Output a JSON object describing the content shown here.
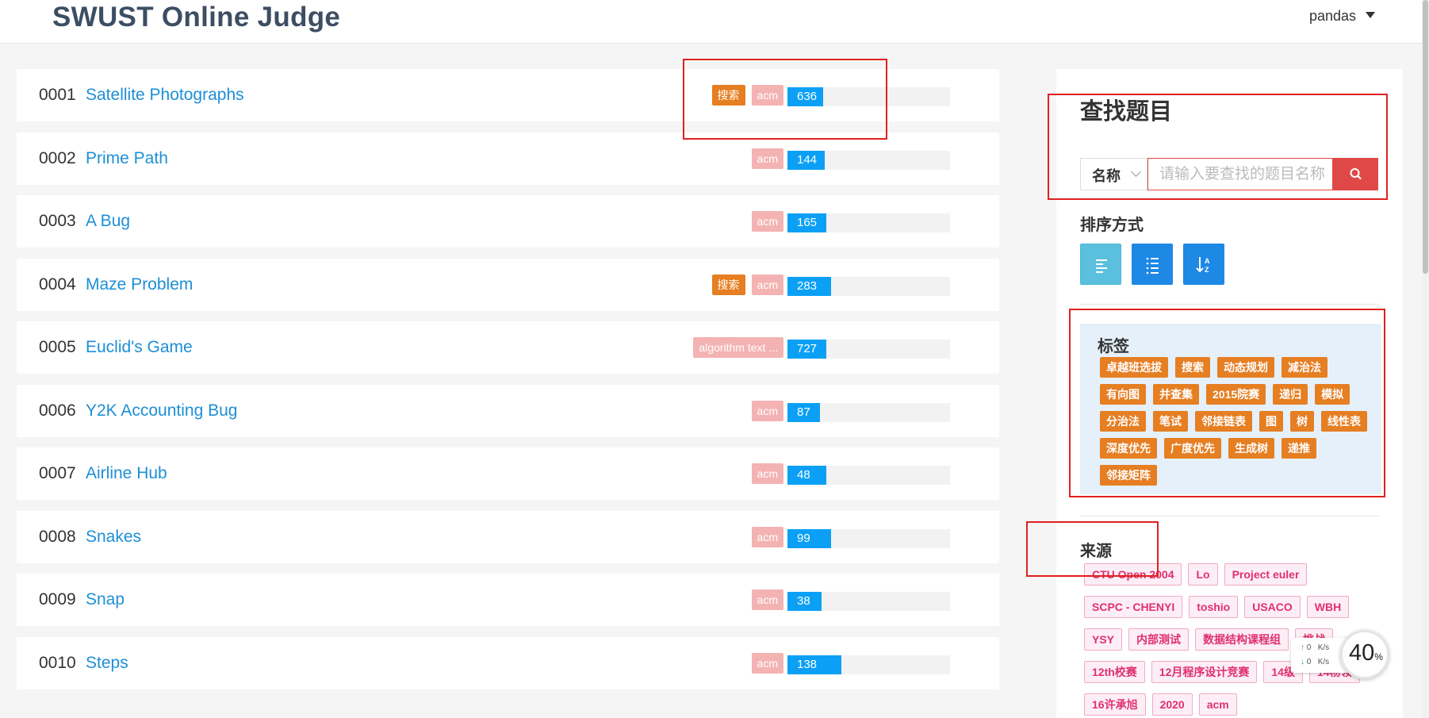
{
  "header": {
    "title": "SWUST Online Judge",
    "user": "pandas"
  },
  "problems": [
    {
      "id": "0001",
      "title": "Satellite Photographs",
      "tags": [
        "搜索",
        "acm"
      ],
      "count": "636",
      "pct": 0.22
    },
    {
      "id": "0002",
      "title": "Prime Path",
      "tags": [
        "acm"
      ],
      "count": "144",
      "pct": 0.23
    },
    {
      "id": "0003",
      "title": "A Bug",
      "tags": [
        "acm"
      ],
      "count": "165",
      "pct": 0.24
    },
    {
      "id": "0004",
      "title": "Maze Problem",
      "tags": [
        "搜索",
        "acm"
      ],
      "count": "283",
      "pct": 0.27
    },
    {
      "id": "0005",
      "title": "Euclid's Game",
      "tags": [
        "algorithm text ..."
      ],
      "count": "727",
      "pct": 0.24
    },
    {
      "id": "0006",
      "title": "Y2K Accounting Bug",
      "tags": [
        "acm"
      ],
      "count": "87",
      "pct": 0.2
    },
    {
      "id": "0007",
      "title": "Airline Hub",
      "tags": [
        "acm"
      ],
      "count": "48",
      "pct": 0.24
    },
    {
      "id": "0008",
      "title": "Snakes",
      "tags": [
        "acm"
      ],
      "count": "99",
      "pct": 0.27
    },
    {
      "id": "0009",
      "title": "Snap",
      "tags": [
        "acm"
      ],
      "count": "38",
      "pct": 0.21
    },
    {
      "id": "0010",
      "title": "Steps",
      "tags": [
        "acm"
      ],
      "count": "138",
      "pct": 0.33
    }
  ],
  "sidebar": {
    "find_title": "查找题目",
    "search_type": "名称",
    "search_placeholder": "请输入要查找的题目名称",
    "sort_label": "排序方式",
    "tags_label": "标签",
    "tags": [
      "卓越班选拔",
      "搜索",
      "动态规划",
      "减治法",
      "有向图",
      "并查集",
      "2015院赛",
      "递归",
      "模拟",
      "分治法",
      "笔试",
      "邻接链表",
      "图",
      "树",
      "线性表",
      "深度优先",
      "广度优先",
      "生成树",
      "递推",
      "邻接矩阵"
    ],
    "source_label": "来源",
    "sources": [
      "CTU Open 2004",
      "Lo",
      "Project euler",
      "SCPC - CHENYI",
      "toshio",
      "USACO",
      "WBH",
      "YSY",
      "内部测试",
      "数据结构课程组",
      "挑战",
      "12th校赛",
      "12月程序设计竞赛",
      "14级",
      "14杨领",
      "16许承旭",
      "2020",
      "acm"
    ]
  },
  "net_widget": {
    "up": "0",
    "down": "0",
    "unit": "K/s",
    "percent": "40",
    "percent_sign": "%"
  },
  "colors": {
    "accent": "#1d8fd6",
    "bar": "#0ba0f5",
    "tag_orange": "#e67e22",
    "tag_pink": "#f4b3b3",
    "search_red": "#e04848",
    "sort_teal": "#5bc0de",
    "sort_blue": "#1e88e5"
  },
  "icons": [
    "search-icon",
    "align-left-icon",
    "list-numbered-icon",
    "sort-az-icon",
    "chevron-down-icon",
    "caret-down-icon"
  ]
}
